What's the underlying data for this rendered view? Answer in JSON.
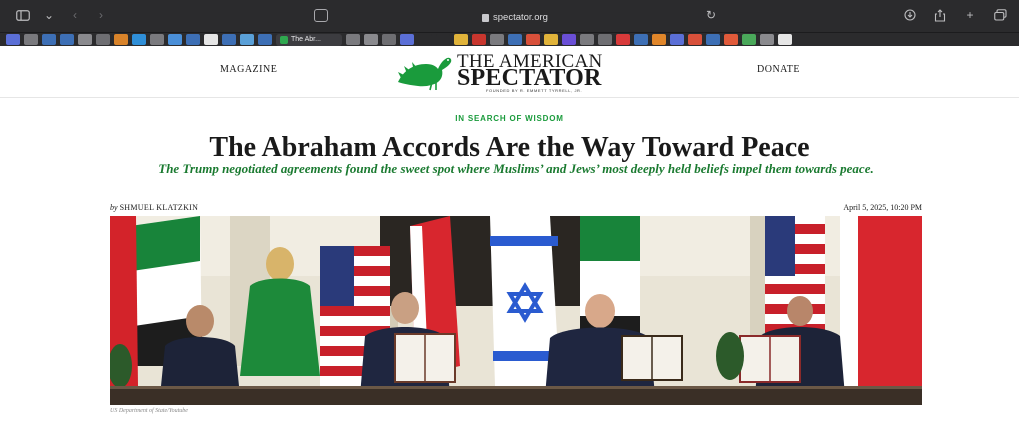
{
  "browser": {
    "url": "spectator.org",
    "active_tab_title": "The Abr..."
  },
  "site": {
    "nav_left": "MAGAZINE",
    "nav_right": "DONATE",
    "logo_line1": "THE AMERICAN",
    "logo_line2": "SPECTATOR",
    "logo_tagline": "FOUNDED BY R. EMMETT TYRRELL, JR."
  },
  "article": {
    "kicker": "IN SEARCH OF WISDOM",
    "headline": "The Abraham Accords Are the Way Toward Peace",
    "dek": "The Trump negotiated agreements found the sweet spot where Muslims’ and Jews’ most deeply held beliefs impel them towards peace.",
    "byline_prefix": "by",
    "author": "SHMUEL KLATZKIN",
    "date": "April 5, 2025, 10:20 PM",
    "image_caption": "US Department of State/Youtube"
  },
  "colors": {
    "brand_green": "#1a9b3c",
    "dek_green": "#1a7a30",
    "chrome_bg": "#2b2b2d"
  }
}
